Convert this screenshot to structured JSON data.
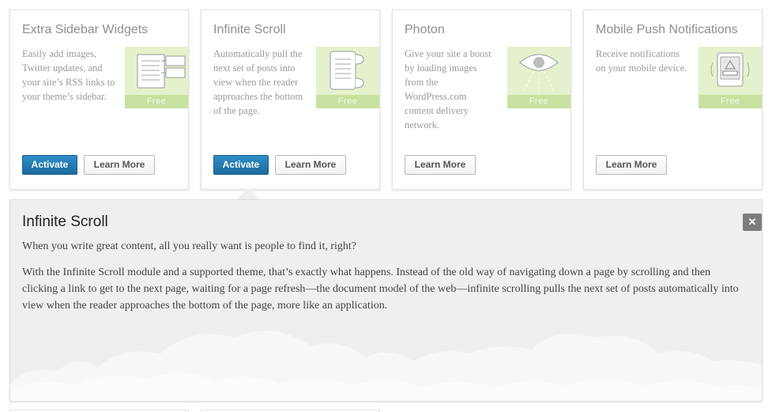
{
  "modules": [
    {
      "title": "Extra Sidebar Widgets",
      "description": "Easily add images, Twitter updates, and your site’s RSS links to your theme’s sidebar.",
      "badge": "Free",
      "icon": "sidebar-widgets-icon",
      "activate_label": "Activate",
      "learn_more_label": "Learn More"
    },
    {
      "title": "Infinite Scroll",
      "description": "Automatically pull the next set of posts into view when the reader approaches the bottom of the page.",
      "badge": "Free",
      "icon": "scroll-icon",
      "activate_label": "Activate",
      "learn_more_label": "Learn More"
    },
    {
      "title": "Photon",
      "description": "Give your site a boost by loading images from the WordPress.com content delivery network.",
      "badge": "Free",
      "icon": "eye-icon",
      "learn_more_label": "Learn More"
    },
    {
      "title": "Mobile Push Notifications",
      "description": "Receive notifications on your mobile device.",
      "badge": "Free",
      "icon": "mobile-device-icon",
      "learn_more_label": "Learn More"
    }
  ],
  "detail": {
    "title": "Infinite Scroll",
    "lead": "When you write great content, all you really want is people to find it, right?",
    "body": "With the Infinite Scroll module and a supported theme, that’s exactly what happens. Instead of the old way of navigating down a page by scrolling and then clicking a link to get to the next page, waiting for a page refresh—the document model of the web—infinite scrolling pulls the next set of posts automatically into view when the reader approaches the bottom of the page, more like an application.",
    "close_glyph": "✕"
  },
  "colors": {
    "primary_button": "#2481be",
    "thumb_bg": "#e5f1cc",
    "thumb_badge": "#c7e1a0",
    "panel_bg": "#efefef"
  }
}
